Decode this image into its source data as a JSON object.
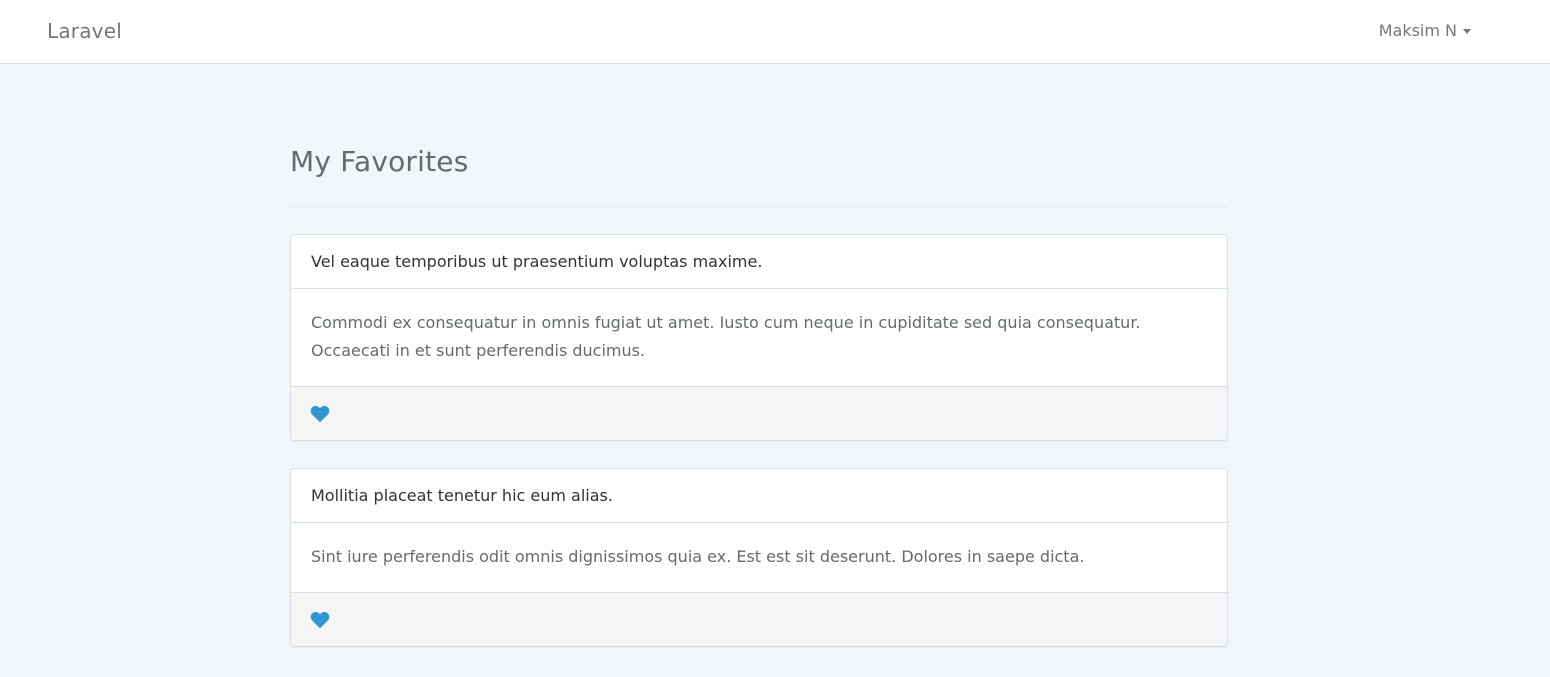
{
  "navbar": {
    "brand": "Laravel",
    "user_name": "Maksim N"
  },
  "page": {
    "title": "My Favorites"
  },
  "favorites": [
    {
      "title": "Vel eaque temporibus ut praesentium voluptas maxime.",
      "body": "Commodi ex consequatur in omnis fugiat ut amet. Iusto cum neque in cupiditate sed quia consequatur. Occaecati in et sunt perferendis ducimus.",
      "favorite_icon": "heart-icon"
    },
    {
      "title": "Mollitia placeat tenetur hic eum alias.",
      "body": "Sint iure perferendis odit omnis dignissimos quia ex. Est est sit deserunt. Dolores in saepe dicta.",
      "favorite_icon": "heart-icon"
    }
  ],
  "colors": {
    "accent": "#3097d1",
    "background": "#f3f6f9",
    "navbar": "#ffffff",
    "panel_footer": "#f5f5f5"
  }
}
